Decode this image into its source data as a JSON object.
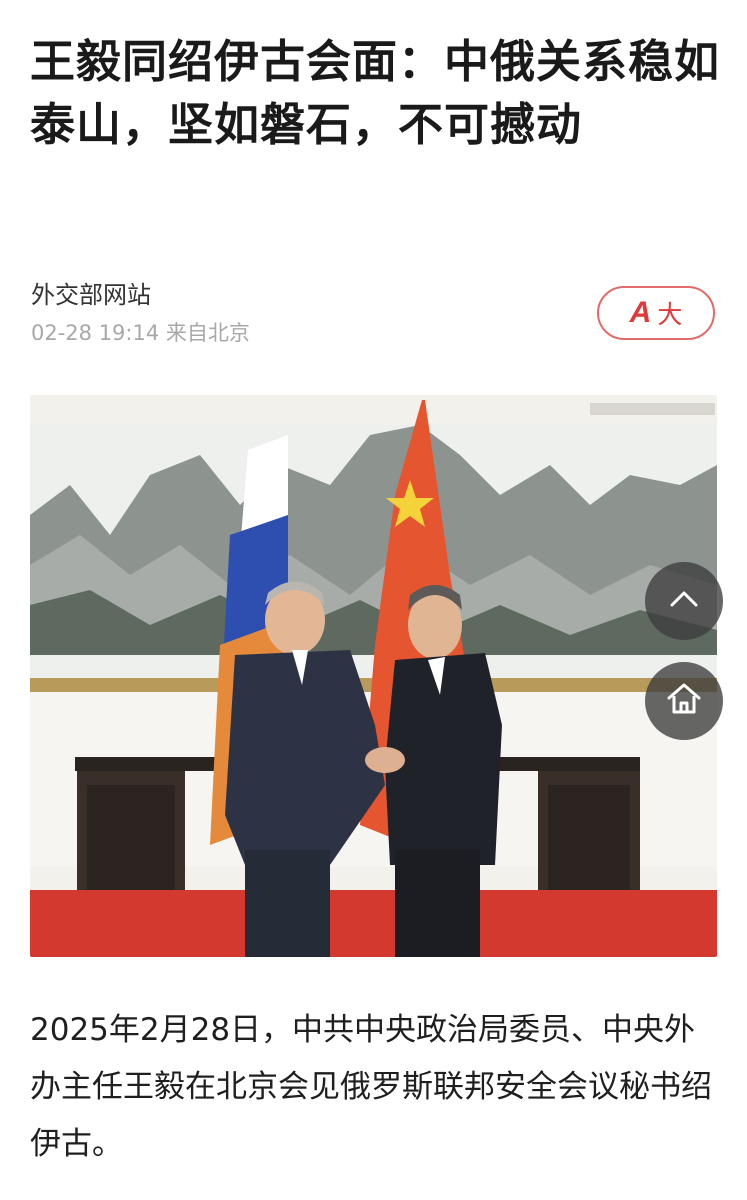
{
  "article": {
    "title": "王毅同绍伊古会面：中俄关系稳如泰山，坚如磐石，不可撼动",
    "source": "外交部网站",
    "meta": "02-28 19:14 来自北京",
    "body": "2025年2月28日，中共中央政治局委员、中央外办主任王毅在北京会见俄罗斯联邦安全会议秘书绍伊古。"
  },
  "font_size_button": {
    "icon_letter": "A",
    "label": "大"
  },
  "colors": {
    "accent": "#e0393c",
    "title": "#1a1a1a",
    "meta": "#a8a8a8"
  },
  "icons": {
    "scroll_top": "chevron-up-icon",
    "home": "home-icon"
  }
}
